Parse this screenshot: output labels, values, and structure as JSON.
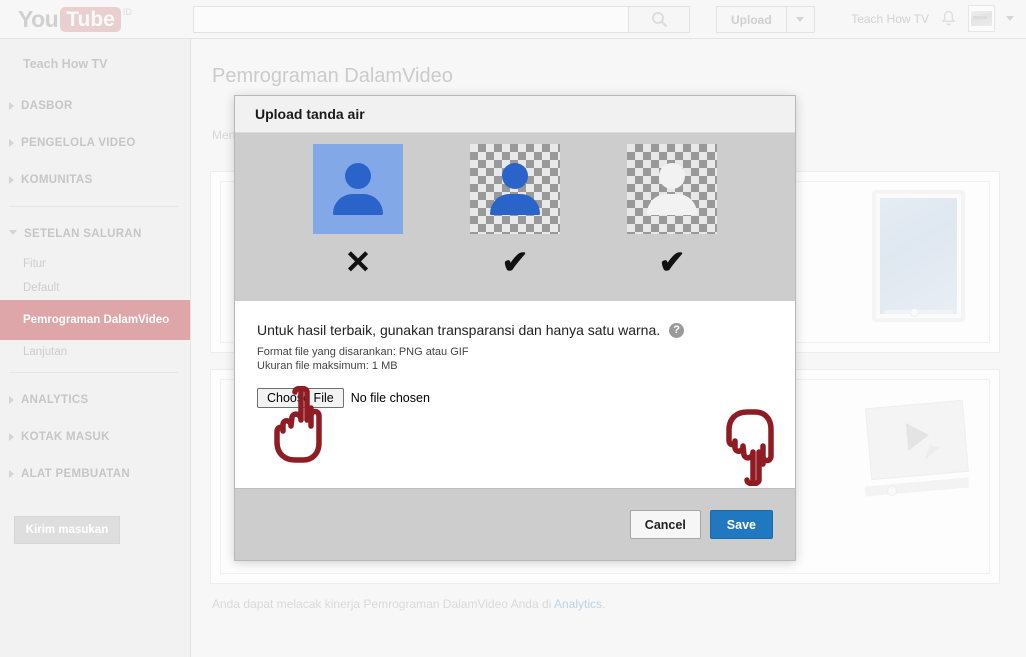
{
  "masthead": {
    "logo_you": "You",
    "logo_tube": "Tube",
    "logo_cc": "ID",
    "search_value": "",
    "search_placeholder": "",
    "search_icon": "search-icon",
    "upload_label": "Upload",
    "account_name": "Teach How TV",
    "bell_icon": "notifications-bell-icon",
    "avatar_icon": "avatar"
  },
  "sidebar": {
    "brand": "Teach How TV",
    "sections": [
      {
        "label": "DASBOR"
      },
      {
        "label": "PENGELOLA VIDEO"
      },
      {
        "label": "KOMUNITAS"
      },
      {
        "label": "SETELAN SALURAN"
      }
    ],
    "sub_items": [
      {
        "label": "Fitur",
        "active": false
      },
      {
        "label": "Default",
        "active": false
      },
      {
        "label": "Pemrograman DalamVideo",
        "active": true
      },
      {
        "label": "Lanjutan",
        "active": false
      }
    ],
    "sections_bottom": [
      {
        "label": "ANALYTICS"
      },
      {
        "label": "KOTAK MASUK"
      },
      {
        "label": "ALAT PEMBUATAN"
      }
    ],
    "feedback_label": "Kirim masukan",
    "active_color": "#dfa6a9"
  },
  "main": {
    "page_title": "Pemrograman DalamVideo",
    "intro_text": "Men… sem… Pemrograman DalamVideo di",
    "footnote_prefix": "Anda dapat melacak kinerja Pemrograman DalamVideo Anda di ",
    "footnote_link": "Analytics",
    "footnote_suffix": ".",
    "link_color": "#bcd4e6"
  },
  "modal": {
    "title": "Upload tanda air",
    "examples": [
      {
        "name": "solid-background-example",
        "style": "solid",
        "person": "blue",
        "mark": "✕",
        "mark_meaning": "bad"
      },
      {
        "name": "transparent-blue-example",
        "style": "checker",
        "person": "blue",
        "mark": "✔",
        "mark_meaning": "good"
      },
      {
        "name": "transparent-white-example",
        "style": "checker",
        "person": "white",
        "mark": "✔",
        "mark_meaning": "good"
      }
    ],
    "hint_main": "Untuk hasil terbaik, gunakan transparansi dan hanya satu warna.",
    "help_icon_glyph": "?",
    "hint_format": "Format file yang disarankan: PNG atau GIF",
    "hint_size": "Ukuran file maksimum: 1 MB",
    "choose_file_label": "Choose File",
    "file_status": "No file chosen",
    "cancel_label": "Cancel",
    "save_label": "Save",
    "save_color": "#2079c0",
    "annotation_hand_up": "pointing-up-hand-annotation",
    "annotation_hand_down": "pointing-down-hand-annotation"
  }
}
